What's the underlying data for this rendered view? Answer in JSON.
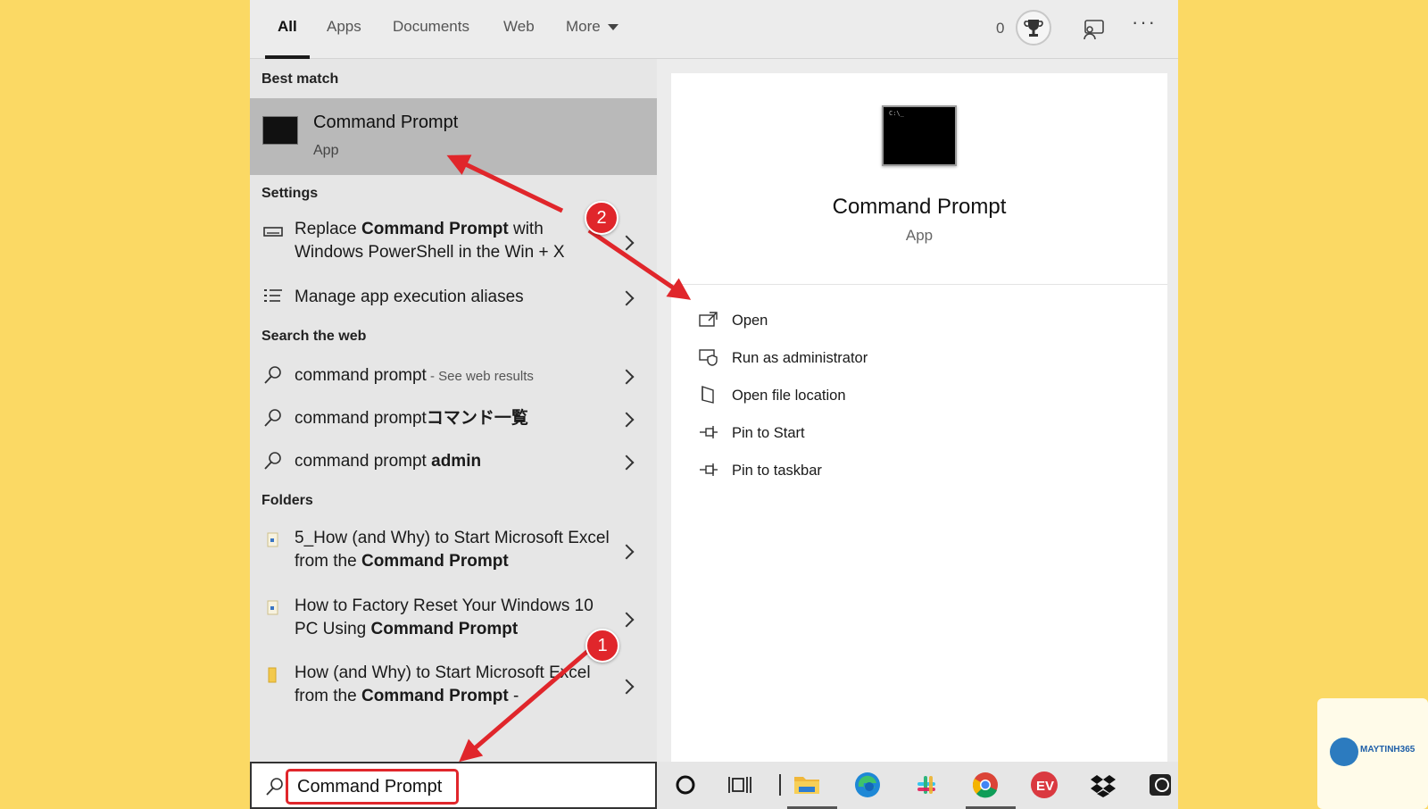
{
  "tabs": [
    {
      "label": "All"
    },
    {
      "label": "Apps"
    },
    {
      "label": "Documents"
    },
    {
      "label": "Web"
    },
    {
      "label": "More"
    }
  ],
  "header": {
    "points": "0"
  },
  "sections": {
    "best_match": "Best match",
    "settings": "Settings",
    "search_web": "Search the web",
    "folders": "Folders"
  },
  "best_match": {
    "title": "Command Prompt",
    "subtitle": "App"
  },
  "settings_items": [
    {
      "pre": "Replace ",
      "bold": "Command Prompt",
      "post": " with Windows PowerShell in the Win + X"
    },
    {
      "label": "Manage app execution aliases"
    }
  ],
  "web_items": [
    {
      "text": "command prompt",
      "hint": " - See web results"
    },
    {
      "text": "command prompt",
      "bold": "コマンド一覧"
    },
    {
      "text": "command prompt ",
      "bold": "admin"
    }
  ],
  "folder_items": [
    {
      "pre": "5_How (and Why) to Start Microsoft Excel from the ",
      "bold": "Command Prompt",
      "post": ""
    },
    {
      "pre": "How to Factory Reset Your Windows 10 PC Using ",
      "bold": "Command Prompt",
      "post": ""
    },
    {
      "pre": "How (and Why) to Start Microsoft Excel from the ",
      "bold": "Command Prompt",
      "post": " -"
    }
  ],
  "search": {
    "value": "Command Prompt"
  },
  "preview": {
    "title": "Command Prompt",
    "subtitle": "App"
  },
  "actions": [
    {
      "label": "Open",
      "icon": "open-icon"
    },
    {
      "label": "Run as administrator",
      "icon": "shield-icon"
    },
    {
      "label": "Open file location",
      "icon": "file-location-icon"
    },
    {
      "label": "Pin to Start",
      "icon": "pin-icon"
    },
    {
      "label": "Pin to taskbar",
      "icon": "pin-icon"
    }
  ],
  "callouts": {
    "one": "1",
    "two": "2"
  },
  "watermark": {
    "brand": "MAYTINH365"
  },
  "colors": {
    "accent": "#e0262b",
    "background": "#fbd964",
    "selected": "#b9b9b9"
  }
}
